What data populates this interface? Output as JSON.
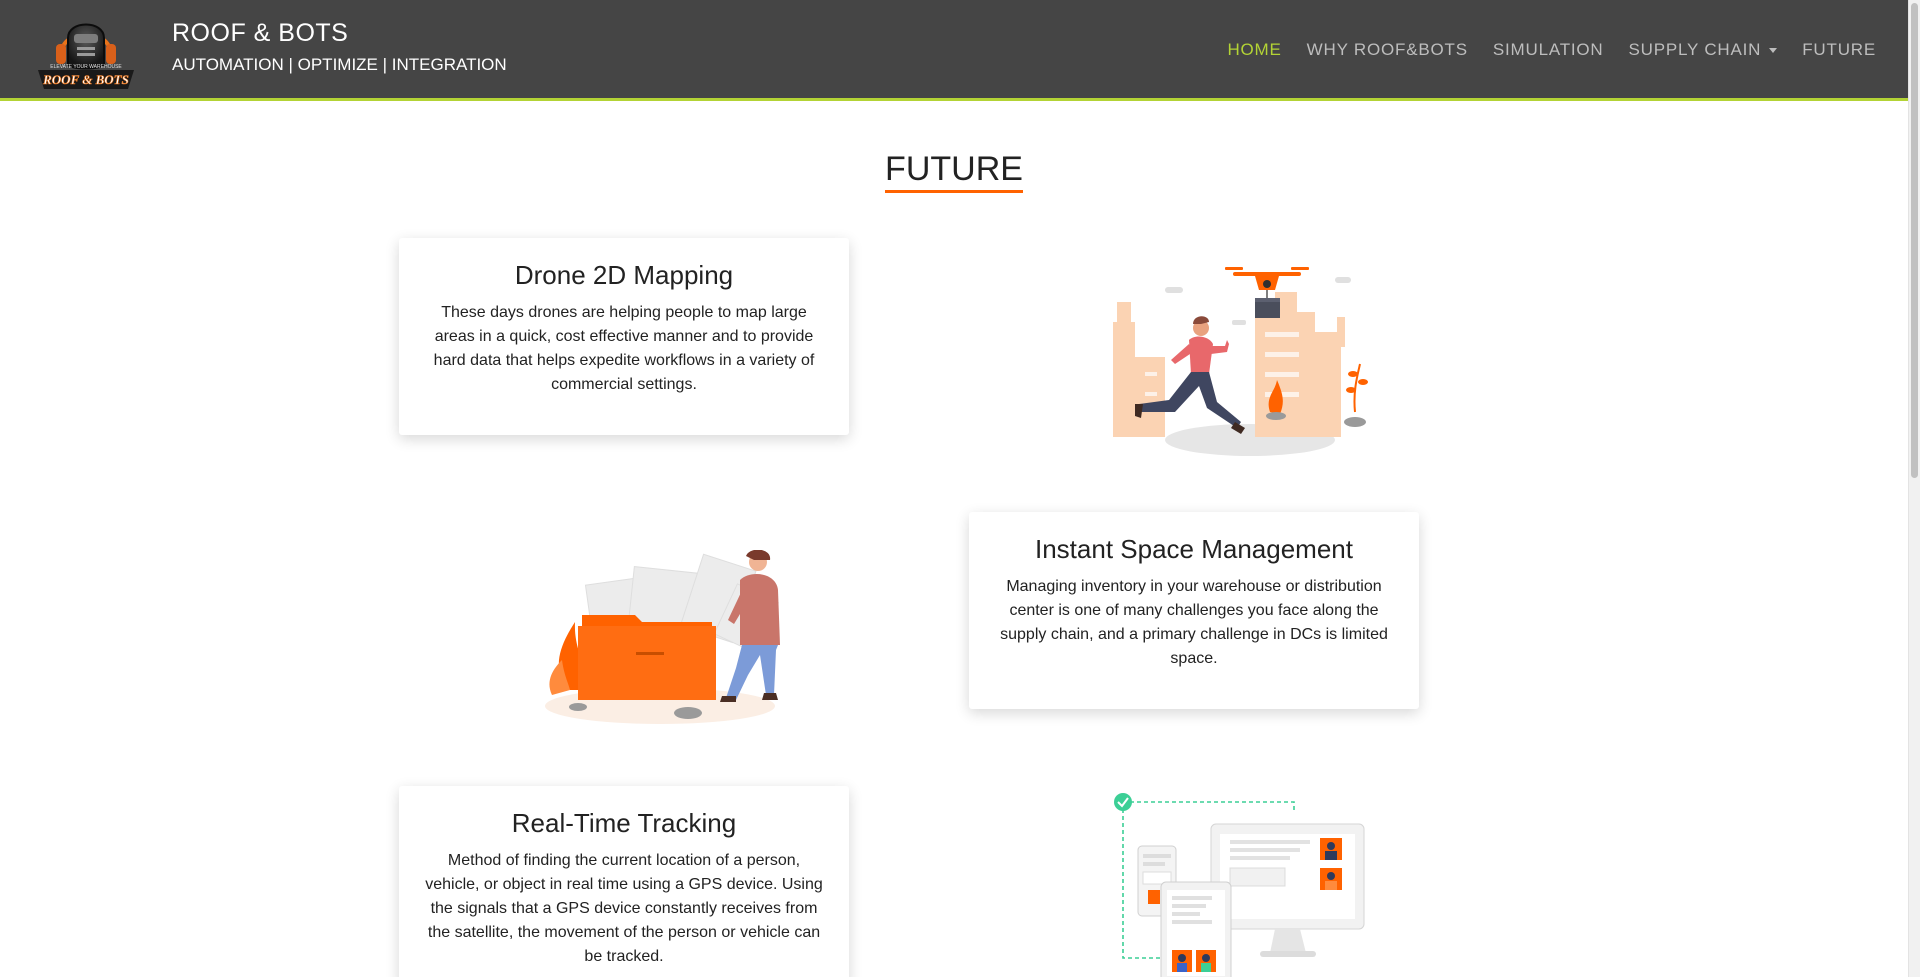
{
  "header": {
    "brand_title": "ROOF & BOTS",
    "tagline": "AUTOMATION | OPTIMIZE | INTEGRATION",
    "logo_text": "ROOF & BOTS",
    "logo_arc_text": "ELEVATE YOUR WAREHOUSE",
    "accent_color": "#b3d335",
    "background_color": "#454545"
  },
  "nav": {
    "items": [
      {
        "label": "HOME",
        "active": true
      },
      {
        "label": "WHY ROOF&BOTS",
        "active": false
      },
      {
        "label": "SIMULATION",
        "active": false
      },
      {
        "label": "SUPPLY CHAIN",
        "active": false,
        "dropdown": true
      },
      {
        "label": "FUTURE",
        "active": false
      }
    ]
  },
  "section": {
    "title": "FUTURE",
    "underline_color": "#ff6200"
  },
  "cards": [
    {
      "title": "Drone 2D Mapping",
      "text": "These days drones are helping people to map large areas in a quick, cost effective manner and to provide hard data that helps expedite workflows in a variety of commercial settings.",
      "illustration": "drone-delivery-illustration"
    },
    {
      "title": "Instant Space Management",
      "text": "Managing inventory in your warehouse or distribution center is one of many challenges you face along the supply chain, and a primary challenge in DCs is limited space.",
      "illustration": "file-folder-illustration"
    },
    {
      "title": "Real-Time Tracking",
      "text": "Method of finding the current location of a person, vehicle, or object in real time using a GPS device. Using the signals that a GPS device constantly receives from the satellite, the movement of the person or vehicle can be tracked.",
      "illustration": "multi-device-tracking-illustration"
    }
  ]
}
